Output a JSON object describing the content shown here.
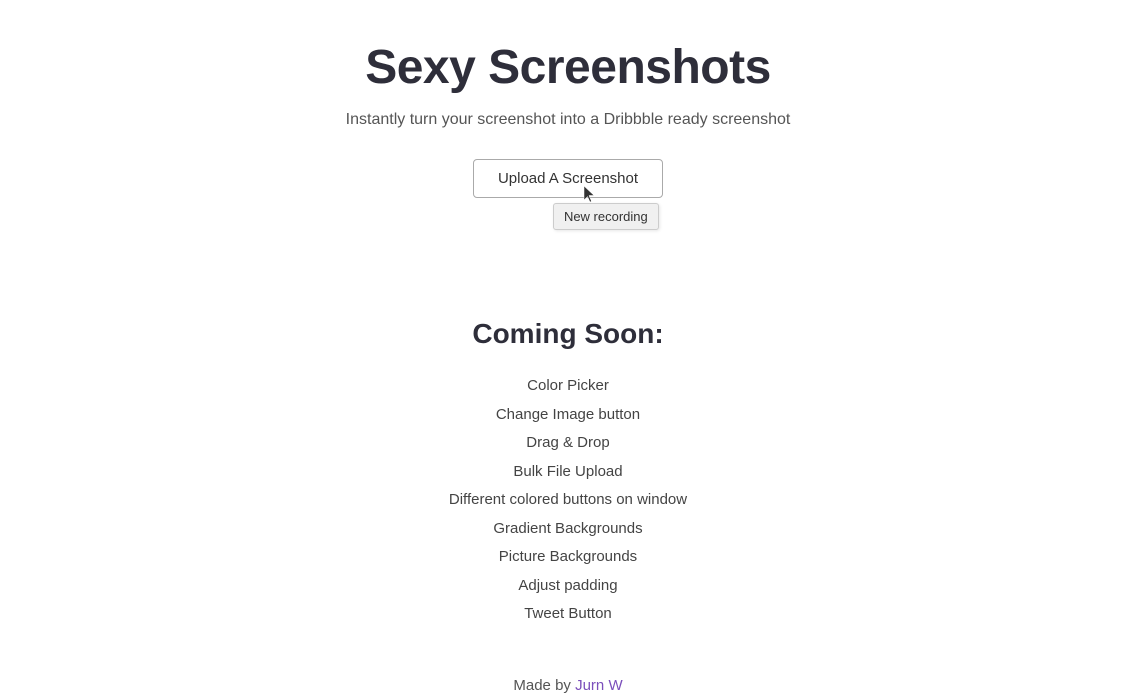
{
  "page": {
    "title": "Sexy Screenshots",
    "subtitle": "Instantly turn your screenshot into a Dribbble ready screenshot",
    "upload_button_label": "Upload A Screenshot",
    "tooltip_label": "New recording",
    "coming_soon_title": "Coming Soon:",
    "coming_soon_items": [
      "Color Picker",
      "Change Image button",
      "Drag & Drop",
      "Bulk File Upload",
      "Different colored buttons on window",
      "Gradient Backgrounds",
      "Picture Backgrounds",
      "Adjust padding",
      "Tweet Button"
    ],
    "footer": {
      "made_by_text": "Made by",
      "author_name": "Jurn W",
      "author_url": "#"
    }
  }
}
